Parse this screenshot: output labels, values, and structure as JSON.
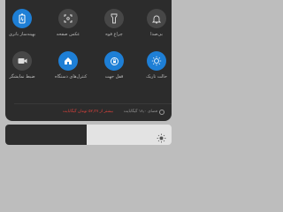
{
  "tiles_row1": [
    {
      "label": "بهینه‌ساز باتری",
      "icon": "battery-icon",
      "active": true
    },
    {
      "label": "عکس صفحه",
      "icon": "screenshot-icon",
      "active": false
    },
    {
      "label": "چراغ قوه",
      "icon": "flashlight-icon",
      "active": false
    },
    {
      "label": "بی‌صدا",
      "icon": "bell-icon",
      "active": false
    }
  ],
  "tiles_row2": [
    {
      "label": "ضبط نمایشگر",
      "icon": "video-camera-icon",
      "active": false
    },
    {
      "label": "کنترل‌های دستگاه",
      "icon": "home-icon",
      "active": true
    },
    {
      "label": "قفل جهت",
      "icon": "rotation-lock-icon",
      "active": true
    },
    {
      "label": "حالت تاریک",
      "icon": "dark-mode-icon",
      "active": true
    }
  ],
  "storage": {
    "used_text": "فضای ۱۸٫۰ گیگابایت",
    "warning_text": "بیشتر از ۵۲٫۳۷ تومان گیگابایت"
  },
  "brightness": {
    "level": 0.49,
    "icon": "sun-icon"
  },
  "colors": {
    "panel": "#2c2c2c",
    "accent": "#1e7fd6",
    "tile_off": "#474747",
    "warning": "#e0433d"
  }
}
